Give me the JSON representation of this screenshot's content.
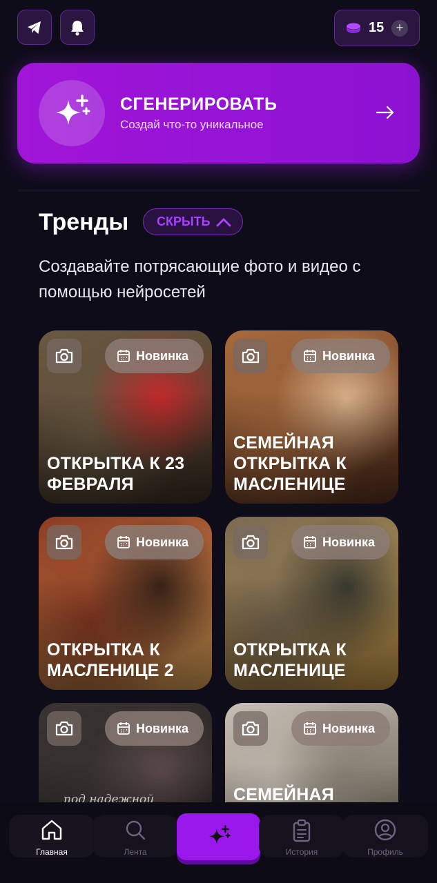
{
  "header": {
    "telegram_icon": "telegram-icon",
    "bell_icon": "bell-icon",
    "coins_count": "15",
    "coins_plus": "+"
  },
  "generate": {
    "title": "СГЕНЕРИРОВАТЬ",
    "subtitle": "Создай что-то уникальное"
  },
  "trends": {
    "title": "Тренды",
    "hide_label": "СКРЫТЬ",
    "description": "Создавайте потрясающие фото и видео с помощью нейросетей"
  },
  "cards": [
    {
      "badge": "Новинка",
      "title": "Открытка к 23 февраля",
      "tone": [
        "#6b5a42",
        "#3d3024",
        "#c22a2a"
      ]
    },
    {
      "badge": "Новинка",
      "title": "Семейная открытка к масленице",
      "tone": [
        "#a86a3e",
        "#5a3320",
        "#d8b28a"
      ]
    },
    {
      "badge": "Новинка",
      "title": "Открытка к масленице 2",
      "tone": [
        "#8a3a22",
        "#e0a45a",
        "#3a2318"
      ]
    },
    {
      "badge": "Новинка",
      "title": "Открытка к масленице",
      "tone": [
        "#7a6a52",
        "#c89a4a",
        "#3a3a30"
      ]
    },
    {
      "badge": "Новинка",
      "title": "",
      "caption": "под надежной защитой",
      "tone": [
        "#3a3434",
        "#1e1a1a",
        "#5a4a48"
      ]
    },
    {
      "badge": "Новинка",
      "title": "Семейная",
      "tone": [
        "#c8c0b6",
        "#5a5242",
        "#8a8276"
      ]
    }
  ],
  "nav": {
    "home": "Главная",
    "feed": "Лента",
    "history": "История",
    "profile": "Профиль"
  }
}
